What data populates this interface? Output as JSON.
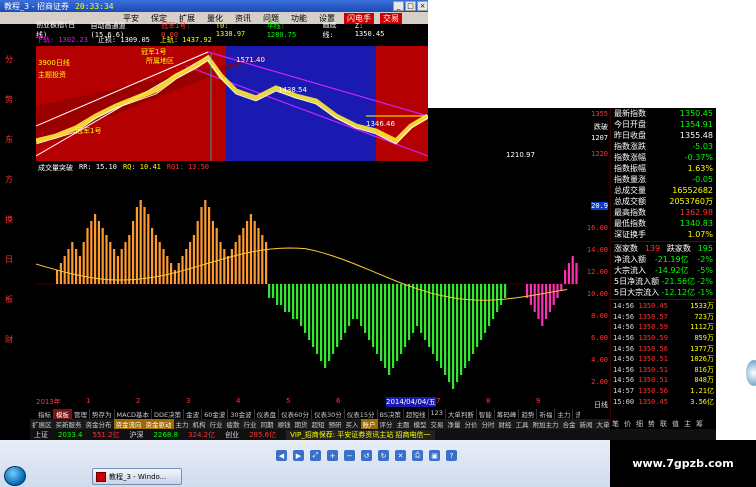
{
  "window": {
    "title": "教程_3 - 招商证券",
    "time": "20:33:34"
  },
  "menubar": {
    "items": [
      "平安",
      "保定",
      "扩展",
      "量化",
      "资讯",
      "问题",
      "功能",
      "设置"
    ],
    "hot_items": [
      "闪电手",
      "交易"
    ]
  },
  "infobar": {
    "index_name": "创业板指(日线)",
    "mode": "自动画通道(15.6.6)",
    "line1_text": "冠军1号: 0.00",
    "line2_ma": "T0: 1338.97",
    "line2_mb": "平线: 1280.75",
    "line2_label": "画底线: ",
    "line2_z": "Z: 1350.45",
    "row2_a": "下轨: 1302.23",
    "row2_b": "止损: 1309.05",
    "row2_c": "上轨: 1437.92"
  },
  "left_strip": {
    "vertical_labels": [
      "分",
      "势",
      "东",
      "方",
      "换",
      "日",
      "板",
      "财"
    ]
  },
  "top_panel": {
    "label_a": "3900日线",
    "label_b": "主题投资",
    "label_c": "所属地区",
    "tag_1": "冠军1号",
    "tag_2": "冠军1号",
    "peak_label": "1571.40",
    "mid_label": "1438.54",
    "mid_label2": "1346.46",
    "low_label": "1210.97",
    "scale_high": "1355",
    "scale_low": "1220",
    "right_tag": "跌破",
    "right_tag2": "1207"
  },
  "chart_data": {
    "type": "bar",
    "title": "成交量突破",
    "indicators": [
      "RR: 15.10",
      "RQ: 10.41",
      "RQ1: 13.50"
    ],
    "x_labels": [
      "2013年",
      "1",
      "2",
      "3",
      "4",
      "5",
      "6",
      "2014/04/04/五",
      "7",
      "8",
      "9"
    ],
    "y_ticks": [
      "20.9",
      "16.00",
      "14.00",
      "12.00",
      "10.00",
      "8.00",
      "6.00",
      "4.00",
      "2.00",
      "日线"
    ],
    "ylim": [
      -16,
      16
    ],
    "orange_values": [
      2,
      3,
      4,
      5,
      6,
      5,
      4,
      6,
      8,
      9,
      10,
      9,
      8,
      7,
      6,
      5,
      4,
      5,
      6,
      7,
      9,
      11,
      12,
      11,
      10,
      8,
      7,
      6,
      5,
      4,
      3,
      2,
      3,
      4,
      5,
      6,
      7,
      9,
      11,
      12,
      11,
      9,
      8,
      6,
      5,
      4,
      5,
      6,
      7,
      8,
      9,
      10,
      9,
      8,
      7,
      6
    ],
    "green_values": [
      -2,
      -2,
      -3,
      -3,
      -4,
      -4,
      -5,
      -5,
      -6,
      -7,
      -8,
      -9,
      -10,
      -11,
      -12,
      -11,
      -10,
      -9,
      -8,
      -7,
      -6,
      -5,
      -5,
      -6,
      -7,
      -8,
      -9,
      -10,
      -11,
      -12,
      -13,
      -12,
      -11,
      -10,
      -9,
      -8,
      -7,
      -6,
      -7,
      -8,
      -9,
      -10,
      -11,
      -12,
      -13,
      -14,
      -15,
      -14,
      -13,
      -12,
      -11,
      -10,
      -9,
      -8,
      -7,
      -6,
      -5,
      -4,
      -3,
      -2
    ],
    "magenta_values": [
      -2,
      -3,
      -4,
      -5,
      -6,
      -5,
      -4,
      -3,
      -2,
      -1,
      2,
      3,
      4,
      3
    ],
    "curve_label": "RR"
  },
  "quote_panel": {
    "rows": [
      {
        "label": "最新指数",
        "value": "1350.45",
        "color": "#0f0"
      },
      {
        "label": "今日开盘",
        "value": "1354.91",
        "color": "#0f0"
      },
      {
        "label": "昨日收盘",
        "value": "1355.48",
        "color": "#fff"
      },
      {
        "label": "指数涨跌",
        "value": "-5.03",
        "color": "#0f0"
      },
      {
        "label": "指数涨幅",
        "value": "-0.37%",
        "color": "#0f0"
      },
      {
        "label": "指数振幅",
        "value": "1.63%",
        "color": "#ff0"
      },
      {
        "label": "指数量涨",
        "value": "-0.05",
        "color": "#0f0"
      },
      {
        "label": "总成交量",
        "value": "16552682",
        "color": "#ff0"
      },
      {
        "label": "总成交额",
        "value": "2053760万",
        "color": "#ff0"
      },
      {
        "label": "最高指数",
        "value": "1362.98",
        "color": "#f33"
      },
      {
        "label": "最低指数",
        "value": "1340.83",
        "color": "#0f0"
      },
      {
        "label": "深证换手",
        "value": "1.07%",
        "color": "#ff0"
      }
    ],
    "updown": {
      "rise_label": "涨家数",
      "rise": "139",
      "fall_label": "跌家数",
      "fall": "195"
    },
    "flows": [
      {
        "label": "净流入额",
        "value": "-21.19亿",
        "pct": "-2%"
      },
      {
        "label": "大宗流入",
        "value": "-14.92亿",
        "pct": "-5%"
      },
      {
        "label": "5日净流入额",
        "value": "-21.56亿",
        "pct": "-2%"
      },
      {
        "label": "5日大宗流入",
        "value": "-12.12亿",
        "pct": "-1%"
      }
    ],
    "ticks": [
      {
        "t": "14:56",
        "p": "1350.45",
        "v": "1533万"
      },
      {
        "t": "14:56",
        "p": "1350.57",
        "v": "723万"
      },
      {
        "t": "14:56",
        "p": "1350.59",
        "v": "1112万"
      },
      {
        "t": "14:56",
        "p": "1350.59",
        "v": "859万"
      },
      {
        "t": "14:56",
        "p": "1350.56",
        "v": "1377万"
      },
      {
        "t": "14:56",
        "p": "1350.51",
        "v": "1026万"
      },
      {
        "t": "14:56",
        "p": "1350.51",
        "v": "816万"
      },
      {
        "t": "14:56",
        "p": "1350.51",
        "v": "848万"
      },
      {
        "t": "14:57",
        "p": "1350.56",
        "v": "1.21亿"
      },
      {
        "t": "15:00",
        "p": "1350.45",
        "v": "3.56亿"
      }
    ]
  },
  "tabrow": {
    "items": [
      "指标",
      "模板",
      "管理",
      "势存为",
      "MACD基本",
      "DDE决策",
      "金波",
      "60金波",
      "30金波",
      "仪表盘",
      "仪表60分",
      "仪表30分",
      "仪表15分",
      "BS决策",
      "超短线",
      "123",
      "大单判断",
      "智能",
      "筹码峰",
      "趋势",
      "祈福",
      "主力",
      "洗盘抽杀",
      "涨停",
      "中线",
      "三剑"
    ],
    "active_index": 1
  },
  "toolrow": {
    "items": [
      "扩展区",
      "买新服务",
      "资金分布",
      "资金流向",
      "资金驱动",
      "主力",
      "机构",
      "行业",
      "疲散",
      "行业",
      "同期",
      "顺钱",
      "期货",
      "超短",
      "预研",
      "买入",
      "账户",
      "评分",
      "主题",
      "模型",
      "交易",
      "净量",
      "分价",
      "分时",
      "财经",
      "工具",
      "附加主力",
      "合金",
      "新闻",
      "大单追踪",
      "控盘"
    ],
    "yellow_indices": [
      3,
      4,
      16
    ]
  },
  "quote_tabs": {
    "items": [
      "笔",
      "价",
      "细",
      "势",
      "联",
      "值",
      "主",
      "筹"
    ]
  },
  "statusbar": {
    "index1": "上证",
    "v1": "2033.4",
    "r1": "551.2亿",
    "index2": "沪深",
    "v2": "2268.8",
    "r2": "324.2亿",
    "index3": "创业",
    "r3": "285.6亿",
    "news": "VIP_招商保荐: 平安证券资讯主站 招商电信一"
  },
  "taskbar": {
    "task_label": "教程_3 - Windo..."
  },
  "watermark": {
    "text": "www.7gpzb.com"
  }
}
